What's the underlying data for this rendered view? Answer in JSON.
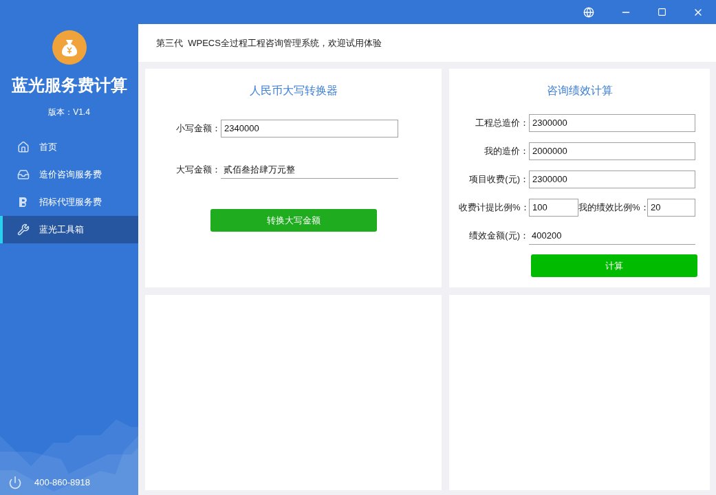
{
  "app": {
    "name": "蓝光服务费计算",
    "version": "版本：V1.4"
  },
  "nav": [
    {
      "label": "首页",
      "selected": false
    },
    {
      "label": "造价咨询服务费",
      "selected": false
    },
    {
      "label": "招标代理服务费",
      "selected": false
    },
    {
      "label": "蓝光工具箱",
      "selected": true
    }
  ],
  "phone": "400-860-8918",
  "banner": "第三代  WPECS全过程工程咨询管理系统，欢迎试用体验",
  "converter": {
    "title": "人民币大写转换器",
    "fields": [
      {
        "label": "小写金额：",
        "value": "2340000",
        "kind": "input"
      },
      {
        "label": "大写金额：",
        "value": "贰佰叁拾肆万元整",
        "kind": "readout"
      }
    ],
    "button": "转换大写金额"
  },
  "performance": {
    "title": "咨询绩效计算",
    "rows": [
      [
        {
          "label": "工程总造价：",
          "value": "2300000",
          "kind": "input"
        }
      ],
      [
        {
          "label": "我的造价：",
          "value": "2000000",
          "kind": "input"
        }
      ],
      [
        {
          "label": "项目收费(元)：",
          "value": "2300000",
          "kind": "input"
        }
      ],
      [
        {
          "label": "收费计提比例%：",
          "value": "100",
          "kind": "input"
        },
        {
          "label": "我的绩效比例%：",
          "value": "20",
          "kind": "input"
        }
      ],
      [
        {
          "label": "绩效金额(元)：",
          "value": "400200",
          "kind": "readout"
        }
      ]
    ],
    "button": "计算"
  }
}
